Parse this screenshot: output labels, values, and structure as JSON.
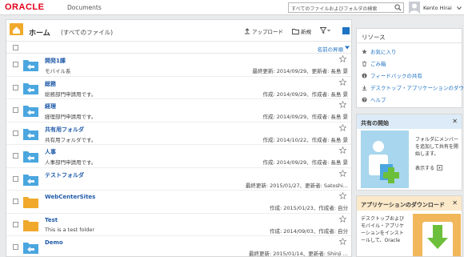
{
  "header": {
    "brand": "ORACLE",
    "product": "Documents",
    "search_placeholder": "すべてのファイルおよびフォルダの検索",
    "user_name": "Kento Hirai"
  },
  "main": {
    "title": "ホーム",
    "subtitle": "(すべてのファイル)",
    "toolbar": {
      "upload": "アップロード",
      "new": "新規"
    },
    "sort_label": "名前の昇順",
    "items": [
      {
        "name": "開発1課",
        "description": "モバイル系",
        "meta": "最終更新: 2014/09/29、更新者: 長島 景",
        "type": "shared-folder"
      },
      {
        "name": "総務",
        "description": "総務部門申請用です。",
        "meta": "作成: 2014/09/29、作成者: 長島 景",
        "type": "shared-folder"
      },
      {
        "name": "経理",
        "description": "経理部門申請用です。",
        "meta": "作成: 2014/09/29、作成者: 長島 景",
        "type": "shared-folder"
      },
      {
        "name": "共有用フォルダ",
        "description": "共有用フォルダです。",
        "meta": "作成: 2014/10/22、作成者: 長島 景",
        "type": "shared-folder"
      },
      {
        "name": "人事",
        "description": "人事部門申請用です。",
        "meta": "作成: 2014/09/29、作成者: 長島 景",
        "type": "shared-folder"
      },
      {
        "name": "テストフォルダ",
        "description": "",
        "meta": "最終更新: 2015/01/27、更新者: Satoshi...",
        "type": "shared-folder"
      },
      {
        "name": "WebCenterSites",
        "description": "",
        "meta": "作成: 2015/01/23、作成者: 自分",
        "type": "folder"
      },
      {
        "name": "Test",
        "description": "This is a test folder",
        "meta": "作成: 2014/09/03、作成者: 自分",
        "type": "folder"
      },
      {
        "name": "Demo",
        "description": "",
        "meta": "最終更新: 2015/01/14、更新者: Shinji ...",
        "type": "shared-folder"
      }
    ]
  },
  "resources": {
    "title": "リソース",
    "items": [
      {
        "label": "お気に入り",
        "icon": "star-icon"
      },
      {
        "label": "ごみ箱",
        "icon": "trash-icon"
      },
      {
        "label": "フィードバックの共有",
        "icon": "info-icon"
      },
      {
        "label": "デスクトップ・アプリケーションのダウ",
        "icon": "download-icon"
      },
      {
        "label": "ヘルプ",
        "icon": "help-icon"
      }
    ]
  },
  "share_panel": {
    "title": "共有の開始",
    "text": "フォルダにメンバーを追加して共有を開始します。",
    "link": "表示する"
  },
  "download_panel": {
    "title": "アプリケーションのダウンロード",
    "text": "デスクトップおよびモバイル・アプリケーションをインストールして、Oracle"
  },
  "colors": {
    "brand_red": "#e3001b",
    "link_blue": "#1f5aa8",
    "folder_blue": "#4aa6df",
    "folder_orange": "#f0a92c"
  }
}
